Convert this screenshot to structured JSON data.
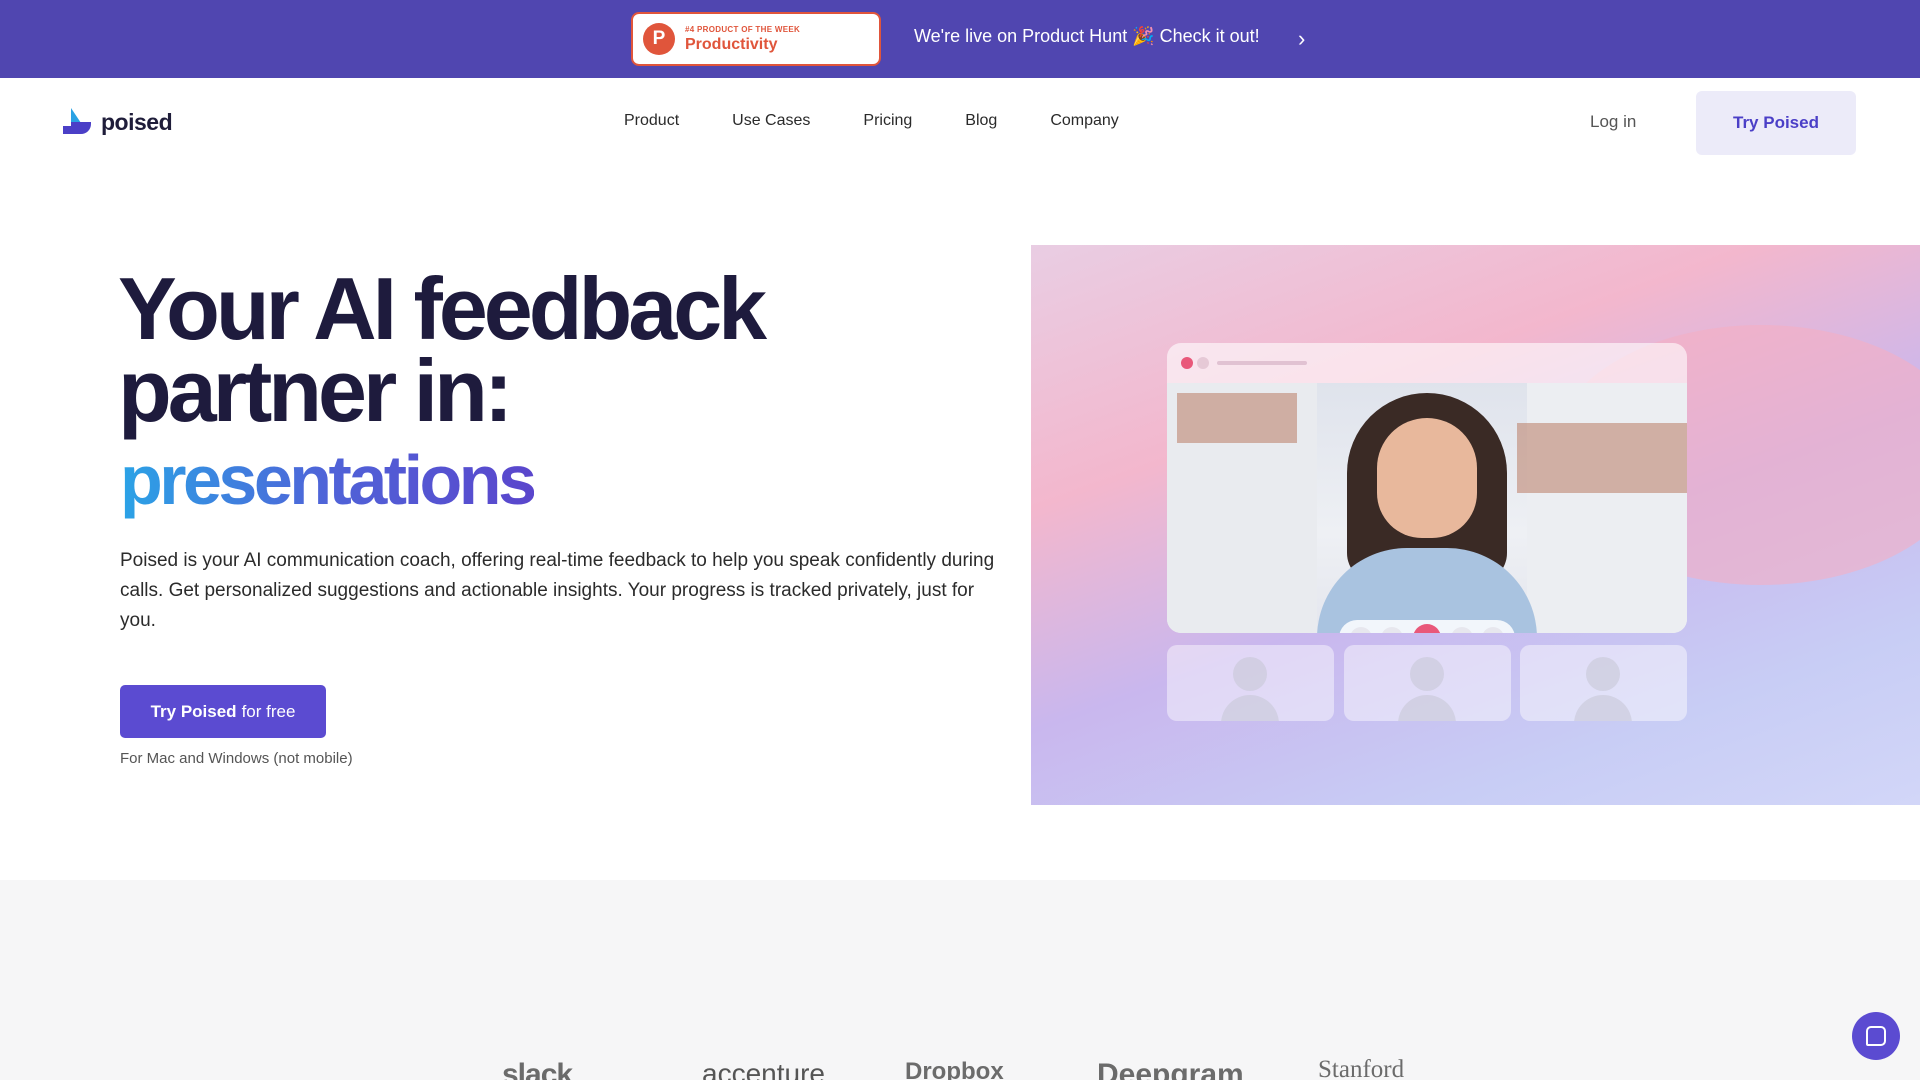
{
  "announcement": {
    "badge_small": "#4 PRODUCT OF THE WEEK",
    "badge_big": "Productivity",
    "badge_logo": "P",
    "text": "We're live on Product Hunt 🎉 Check it out!",
    "chevron": "›"
  },
  "nav": {
    "brand": "poised",
    "links": [
      "Product",
      "Use Cases",
      "Pricing",
      "Blog",
      "Company"
    ],
    "login": "Log in",
    "try_button": "Try Poised"
  },
  "hero": {
    "title": "Your AI feedback partner in:",
    "rotating_word": "presentations",
    "description": "Poised is your AI communication coach, offering real-time feedback to help you speak confidently during calls. Get personalized suggestions and actionable insights. Your progress is tracked privately, just for you.",
    "cta_bold": "Try Poised",
    "cta_rest": "for free",
    "cta_note": "For Mac and Windows (not mobile)"
  },
  "illustration": {
    "controls": [
      "camera-icon",
      "mic-icon",
      "end-call-icon",
      "add-person-icon",
      "more-icon"
    ]
  },
  "customer_logos": [
    "slack",
    "accenture",
    "Dropbox",
    "Deepgram",
    "Stanford"
  ],
  "colors": {
    "announcement_bg": "#5046b0",
    "accent": "#5b4bd1",
    "product_hunt": "#e0553b",
    "headline": "#1e1b3d"
  }
}
